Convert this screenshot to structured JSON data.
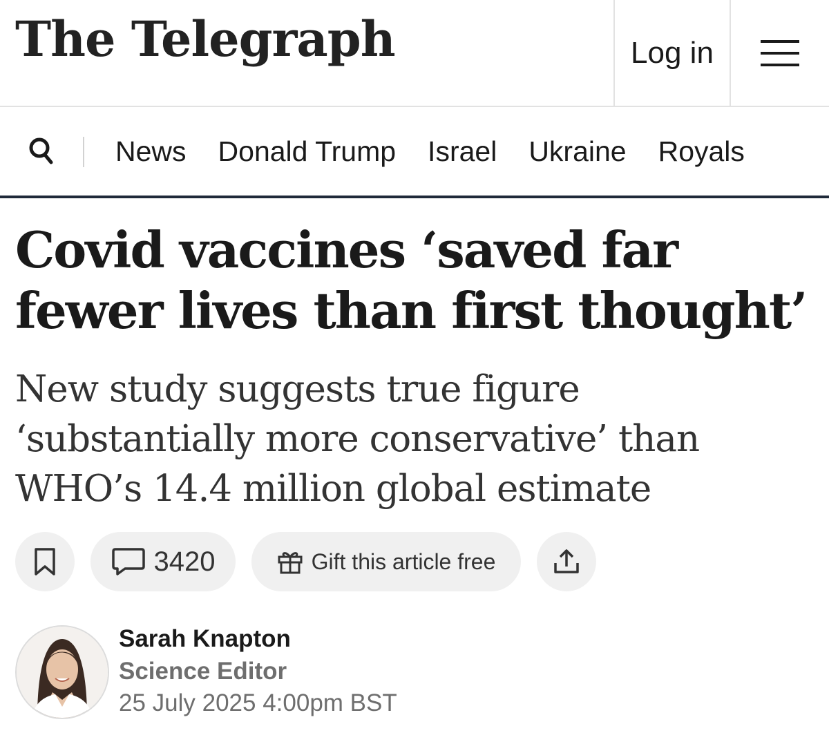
{
  "header": {
    "masthead": "The Telegraph",
    "login_label": "Log in",
    "menu_icon": "hamburger-menu-icon"
  },
  "nav": {
    "search_icon": "search-icon",
    "items": [
      "News",
      "Donald Trump",
      "Israel",
      "Ukraine",
      "Royals"
    ]
  },
  "article": {
    "headline_line1": "Covid vaccines ‘saved far",
    "headline_line2": "fewer lives than first thought’",
    "standfirst_line1": "New study suggests true figure",
    "standfirst_line2": "‘substantially more conservative’ than",
    "standfirst_line3": "WHO’s 14.4 million global estimate"
  },
  "actions": {
    "save_icon": "bookmark-icon",
    "comment_icon": "comment-icon",
    "comment_count": "3420",
    "gift_icon": "gift-icon",
    "gift_label": "Gift this article free",
    "share_icon": "share-icon"
  },
  "byline": {
    "author": "Sarah Knapton",
    "role": "Science Editor",
    "date": "25 July 2025 4:00pm BST"
  },
  "colors": {
    "nav_rule": "#1f2a3a",
    "pill_bg": "#f0f0f0",
    "muted_text": "#6e6e6e"
  }
}
